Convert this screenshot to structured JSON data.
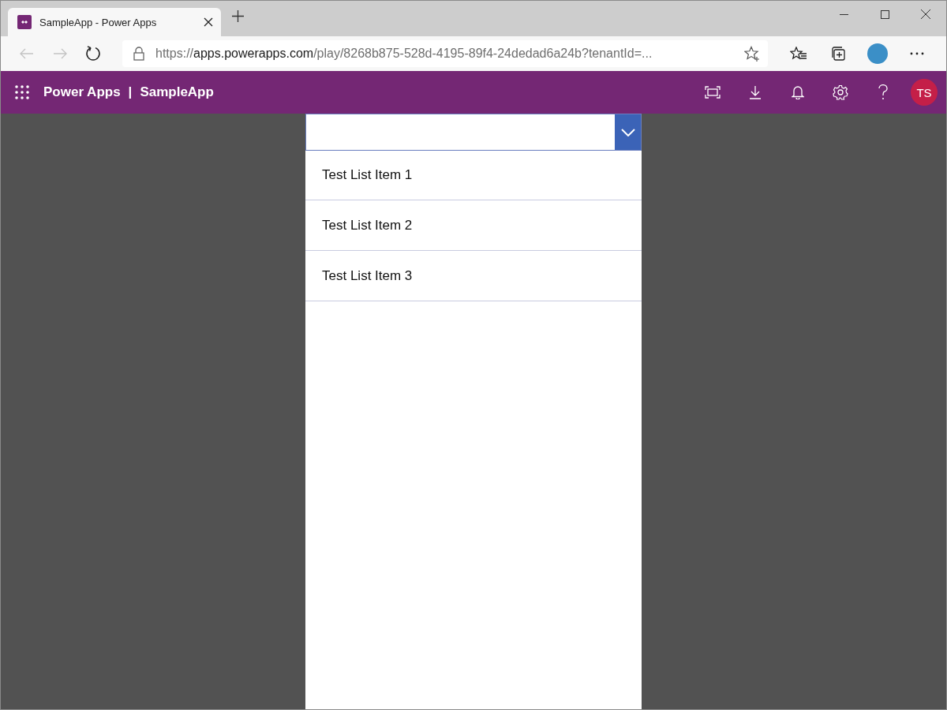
{
  "browser": {
    "tab": {
      "title": "SampleApp - Power Apps"
    },
    "url": {
      "scheme": "https://",
      "host": "apps.powerapps.com",
      "rest": "/play/8268b875-528d-4195-89f4-24dedad6a24b?tenantId=..."
    }
  },
  "app_header": {
    "product": "Power Apps",
    "separator": "|",
    "app_name": "SampleApp",
    "avatar_initials": "TS"
  },
  "dropdown": {
    "expanded": true
  },
  "list_items": [
    {
      "label": "Test List Item 1"
    },
    {
      "label": "Test List Item 2"
    },
    {
      "label": "Test List Item 3"
    }
  ]
}
